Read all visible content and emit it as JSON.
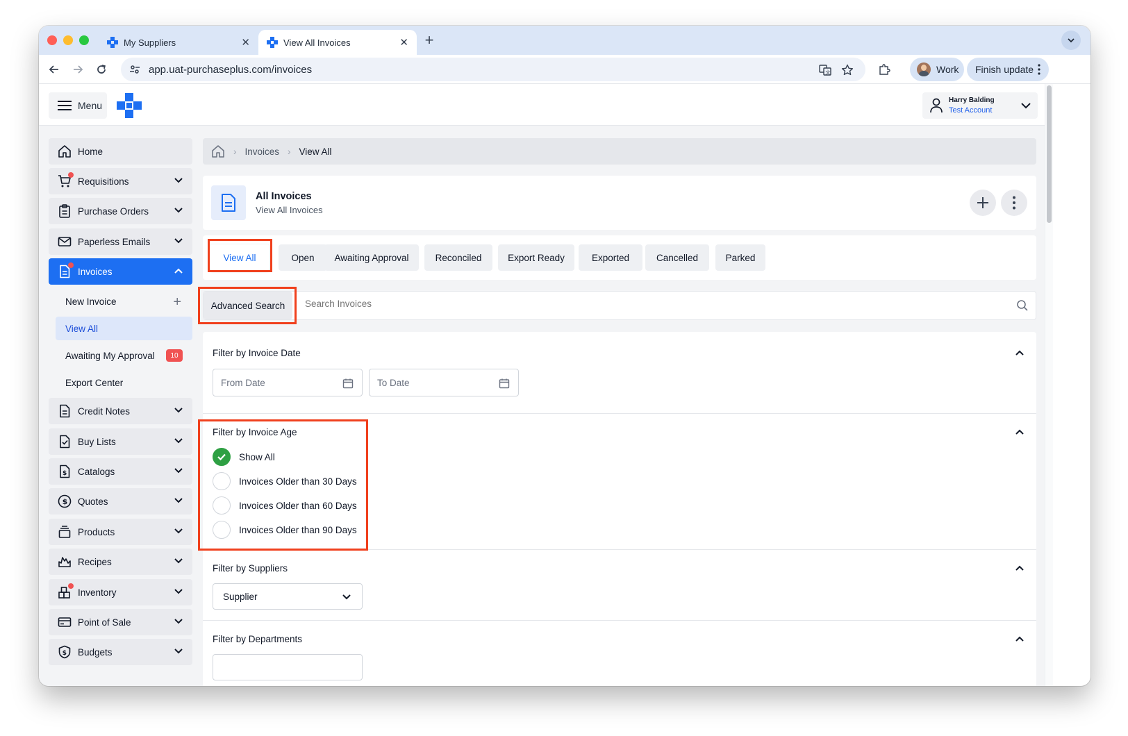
{
  "browser": {
    "tabs": [
      {
        "title": "My Suppliers",
        "close": "✕"
      },
      {
        "title": "View All Invoices",
        "close": "✕"
      }
    ],
    "new_tab": "+",
    "url": "app.uat-purchaseplus.com/invoices",
    "profile_label": "Work",
    "finish_update_label": "Finish update"
  },
  "header": {
    "menu_label": "Menu",
    "user_name": "Harry Balding",
    "user_account": "Test Account"
  },
  "sidebar": {
    "items": [
      {
        "label": "Home",
        "icon": "home-icon",
        "expandable": false
      },
      {
        "label": "Requisitions",
        "icon": "cart-icon",
        "expandable": true,
        "dot": true
      },
      {
        "label": "Purchase Orders",
        "icon": "clipboard-icon",
        "expandable": true
      },
      {
        "label": "Paperless Emails",
        "icon": "mail-icon",
        "expandable": true
      },
      {
        "label": "Invoices",
        "icon": "document-icon",
        "expandable": true,
        "active": true,
        "dot": true
      },
      {
        "label": "Credit Notes",
        "icon": "document-icon",
        "expandable": true
      },
      {
        "label": "Buy Lists",
        "icon": "checklist-icon",
        "expandable": true
      },
      {
        "label": "Catalogs",
        "icon": "dollar-doc-icon",
        "expandable": true
      },
      {
        "label": "Quotes",
        "icon": "dollar-circle-icon",
        "expandable": true
      },
      {
        "label": "Products",
        "icon": "stack-icon",
        "expandable": true
      },
      {
        "label": "Recipes",
        "icon": "flame-icon",
        "expandable": true
      },
      {
        "label": "Inventory",
        "icon": "boxes-icon",
        "expandable": true,
        "dot": true
      },
      {
        "label": "Point of Sale",
        "icon": "card-icon",
        "expandable": true
      },
      {
        "label": "Budgets",
        "icon": "shield-dollar-icon",
        "expandable": true
      }
    ],
    "invoice_subitems": [
      {
        "label": "New Invoice"
      },
      {
        "label": "View All"
      },
      {
        "label": "Awaiting My Approval",
        "count": "10"
      },
      {
        "label": "Export Center"
      }
    ]
  },
  "breadcrumb": {
    "items": [
      "Invoices",
      "View All"
    ]
  },
  "page": {
    "title": "All Invoices",
    "subtitle": "View All Invoices"
  },
  "filter_tabs": [
    "View All",
    "Open",
    "Awaiting Approval",
    "Reconciled",
    "Export Ready",
    "Exported",
    "Cancelled",
    "Parked"
  ],
  "search": {
    "advanced_label": "Advanced Search",
    "placeholder": "Search Invoices"
  },
  "filters": {
    "invoice_date": {
      "title": "Filter by Invoice Date",
      "from_placeholder": "From Date",
      "to_placeholder": "To Date"
    },
    "invoice_age": {
      "title": "Filter by Invoice Age",
      "options": [
        {
          "label": "Show All",
          "checked": true
        },
        {
          "label": "Invoices Older than 30 Days",
          "checked": false
        },
        {
          "label": "Invoices Older than 60 Days",
          "checked": false
        },
        {
          "label": "Invoices Older than 90 Days",
          "checked": false
        }
      ]
    },
    "suppliers": {
      "title": "Filter by Suppliers",
      "select_value": "Supplier"
    },
    "departments": {
      "title": "Filter by Departments"
    }
  },
  "colors": {
    "accent": "#1d6ff2",
    "highlight": "#f0401d",
    "success": "#2ea043",
    "badge": "#f05252"
  }
}
